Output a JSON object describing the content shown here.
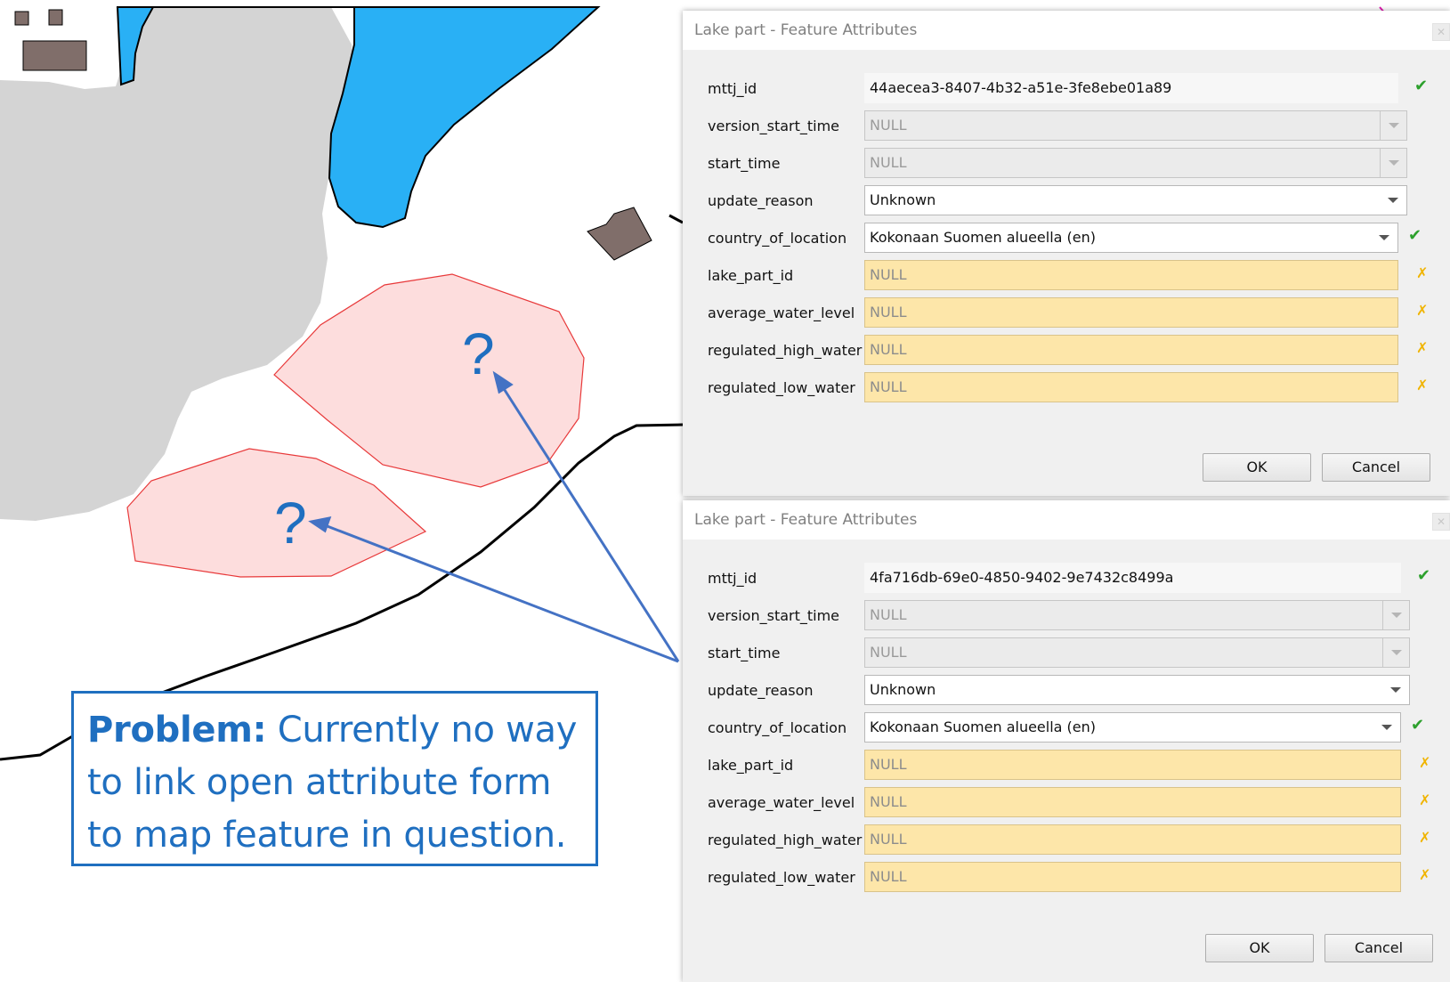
{
  "map": {
    "question_marks": [
      "?",
      "?"
    ],
    "colors": {
      "water": "#29b0f5",
      "land_gray": "#d4d4d4",
      "building": "#806e6a",
      "lake_part_fill": "#fddddd",
      "lake_part_stroke": "#e8393a",
      "road": "#000000",
      "annotation": "#4472c4"
    }
  },
  "callout": {
    "bold": "Problem:",
    "text": " Currently no way to link open attribute form to map feature in question."
  },
  "dialogs": [
    {
      "title": "Lake part - Feature Attributes",
      "fields": {
        "mttj_id": {
          "label": "mttj_id",
          "value": "44aecea3-8407-4b32-a51e-3fe8ebe01a89"
        },
        "version_start_time": {
          "label": "version_start_time",
          "value": "NULL"
        },
        "start_time": {
          "label": "start_time",
          "value": "NULL"
        },
        "update_reason": {
          "label": "update_reason",
          "value": "Unknown"
        },
        "country_of_location": {
          "label": "country_of_location",
          "value": "Kokonaan Suomen alueella (en)"
        },
        "lake_part_id": {
          "label": "lake_part_id",
          "value": "NULL"
        },
        "average_water_level": {
          "label": "average_water_level",
          "value": "NULL"
        },
        "regulated_high_water": {
          "label": "regulated_high_water",
          "value": "NULL"
        },
        "regulated_low_water": {
          "label": "regulated_low_water",
          "value": "NULL"
        }
      },
      "ok_label": "OK",
      "cancel_label": "Cancel"
    },
    {
      "title": "Lake part - Feature Attributes",
      "fields": {
        "mttj_id": {
          "label": "mttj_id",
          "value": "4fa716db-69e0-4850-9402-9e7432c8499a"
        },
        "version_start_time": {
          "label": "version_start_time",
          "value": "NULL"
        },
        "start_time": {
          "label": "start_time",
          "value": "NULL"
        },
        "update_reason": {
          "label": "update_reason",
          "value": "Unknown"
        },
        "country_of_location": {
          "label": "country_of_location",
          "value": "Kokonaan Suomen alueella (en)"
        },
        "lake_part_id": {
          "label": "lake_part_id",
          "value": "NULL"
        },
        "average_water_level": {
          "label": "average_water_level",
          "value": "NULL"
        },
        "regulated_high_water": {
          "label": "regulated_high_water",
          "value": "NULL"
        },
        "regulated_low_water": {
          "label": "regulated_low_water",
          "value": "NULL"
        }
      },
      "ok_label": "OK",
      "cancel_label": "Cancel"
    }
  ],
  "icons": {
    "valid": "check-icon",
    "invalid": "cross-icon",
    "dropdown": "chevron-down-icon",
    "close": "close-icon"
  }
}
